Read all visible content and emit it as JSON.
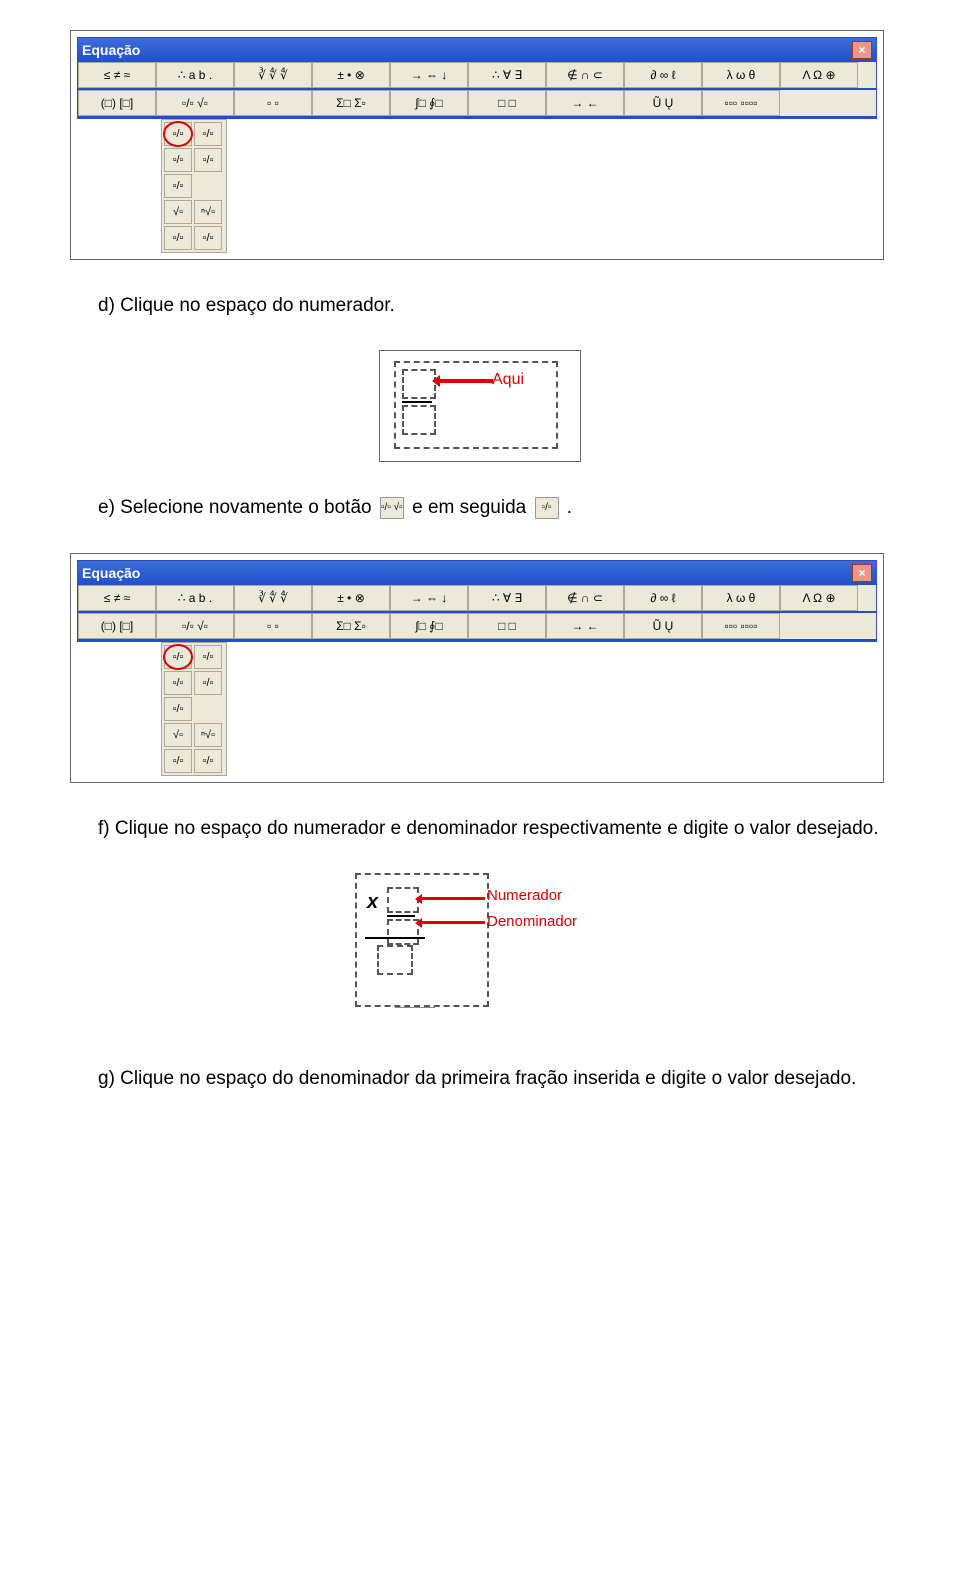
{
  "eq_toolbar": {
    "title": "Equação",
    "close": "×",
    "row1": [
      "≤ ≠ ≈",
      "∴ a b .",
      "∛ ∜ ∜",
      "± • ⊗",
      "→ ⇔ ↓",
      "∴ ∀ ∃",
      "∉ ∩ ⊂",
      "∂ ∞ ℓ",
      "λ ω θ",
      "Λ Ω ⊕"
    ],
    "row2": [
      "(□) [□]",
      "▫/▫ √▫",
      "▫ ▫",
      "Σ□ Σ▫",
      "∫□ ∮□",
      "□ □",
      "→ ←",
      "Ũ Ų",
      "▫▫▫ ▫▫▫▫"
    ],
    "dropdown": [
      [
        "▫/▫",
        "▫/▫"
      ],
      [
        "▫/▫",
        "▫/▫"
      ],
      [
        "▫/▫",
        ""
      ],
      [
        "√▫",
        "ⁿ√▫"
      ],
      [
        "▫/▫",
        "▫/▫"
      ]
    ]
  },
  "steps": {
    "d": "d) Clique no espaço do numerador.",
    "e_pre": "e) Selecione novamente o botão ",
    "e_mid": " e em seguida ",
    "e_end": ".",
    "f": "f) Clique no espaço do numerador e denominador respectivamente e digite o valor desejado.",
    "g": "g) Clique no espaço do denominador da primeira fração inserida e digite o valor desejado."
  },
  "annotations": {
    "aqui": "Aqui",
    "numerador": "Numerador",
    "denominador": "Denominador",
    "x": "x"
  },
  "icons": {
    "frac_root": "▫/▫ √▫",
    "frac": "▫/▫"
  }
}
